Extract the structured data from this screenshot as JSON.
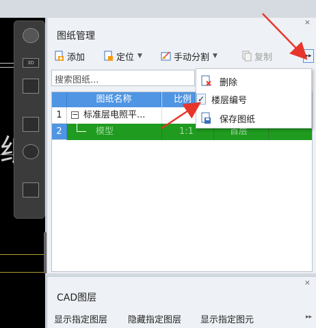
{
  "panel": {
    "close_glyph": "×",
    "title": "图纸管理",
    "toolbar": {
      "add": "添加",
      "locate": "定位",
      "manual_split": "手动分割",
      "copy": "复制",
      "more_glyph": "▸▸"
    },
    "search_placeholder": "搜索图纸...",
    "table": {
      "columns": [
        "图纸名称",
        "比例"
      ],
      "rows": [
        {
          "num": "1",
          "toggle": "−",
          "name": "标准层电照平...",
          "scale": "",
          "floor": ""
        },
        {
          "num": "2",
          "toggle": "",
          "name": "模型",
          "scale": "1:1",
          "floor": "首层"
        }
      ]
    }
  },
  "context_menu": {
    "items": [
      {
        "label": "删除",
        "icon": "delete-icon",
        "checked": false
      },
      {
        "label": "楼层编号",
        "icon": "check-icon",
        "checked": true
      },
      {
        "label": "保存图纸",
        "icon": "save-icon",
        "checked": false
      }
    ],
    "check_glyph": "✓"
  },
  "cad_canvas": {
    "text": "纸管的"
  },
  "layers": {
    "close_glyph": "×",
    "title": "CAD图层",
    "buttons": [
      "显示指定图层",
      "隐藏指定图层",
      "显示指定图元"
    ],
    "more_glyph": "▸▸"
  },
  "colors": {
    "header_blue": "#4f95e3",
    "selected_green": "#1f9b1f",
    "annotation_red": "#e8352b"
  }
}
